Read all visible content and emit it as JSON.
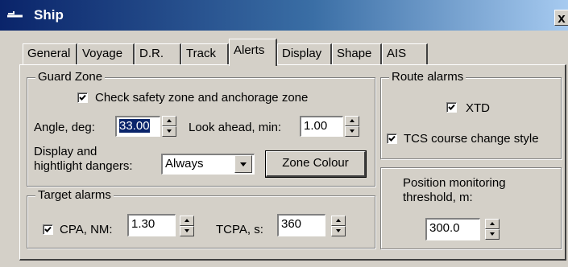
{
  "window": {
    "title": "Ship",
    "close_label": "x"
  },
  "tabs": [
    "General",
    "Voyage",
    "D.R.",
    "Track",
    "Alerts",
    "Display",
    "Shape",
    "AIS"
  ],
  "active_tab": "Alerts",
  "guard_zone": {
    "label": "Guard Zone",
    "check_safety_label": "Check safety zone and anchorage zone",
    "check_safety_checked": true,
    "angle_label": "Angle, deg:",
    "angle_value": "33.00",
    "look_ahead_label": "Look ahead, min:",
    "look_ahead_value": "1.00",
    "display_dangers_label_1": "Display and",
    "display_dangers_label_2": "hightlight dangers:",
    "display_dangers_value": "Always",
    "zone_colour_label": "Zone Colour"
  },
  "target_alarms": {
    "label": "Target alarms",
    "cpa_label": "CPA, NM:",
    "cpa_checked": true,
    "cpa_value": "1.30",
    "tcpa_label": "TCPA, s:",
    "tcpa_value": "360"
  },
  "route_alarms": {
    "label": "Route alarms",
    "xtd_label": "XTD",
    "xtd_checked": true,
    "tcs_label": "TCS course change style",
    "tcs_checked": true
  },
  "position_monitoring": {
    "label_1": "Position monitoring",
    "label_2": "threshold, m:",
    "value": "300.0"
  },
  "colors": {
    "face": "#d4d0c8",
    "title_start": "#0a246a",
    "title_end": "#a6caf0",
    "selection": "#0a246a"
  },
  "icons": {
    "title": "ship-icon",
    "close": "close-icon",
    "spin_up": "spin-up-icon",
    "spin_down": "spin-down-icon",
    "dropdown": "chevron-down-icon"
  }
}
